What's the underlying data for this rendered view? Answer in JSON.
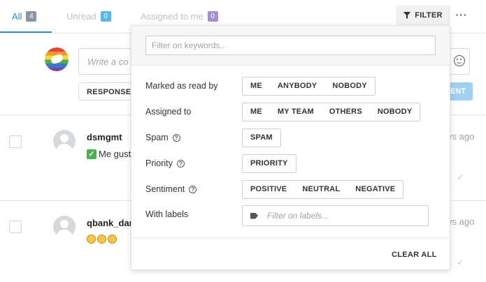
{
  "tabs": [
    {
      "label": "All",
      "count": "4"
    },
    {
      "label": "Unread",
      "count": "0"
    },
    {
      "label": "Assigned to me",
      "count": "0"
    }
  ],
  "toolbar": {
    "filter_label": "FILTER",
    "more_label": "···"
  },
  "compose": {
    "placeholder": "Write a co",
    "response_label": "RESPONSE T",
    "send_label": "ENT"
  },
  "messages": [
    {
      "username": "dsmgmt",
      "text": "Me gust",
      "time": "ys ago"
    },
    {
      "username": "qbank_dar",
      "text": "",
      "time": "ys ago"
    }
  ],
  "filter_panel": {
    "keywords_placeholder": "Filter on keywords...",
    "rows": [
      {
        "label": "Marked as read by",
        "options": [
          "ME",
          "ANYBODY",
          "NOBODY"
        ]
      },
      {
        "label": "Assigned to",
        "options": [
          "ME",
          "MY TEAM",
          "OTHERS",
          "NOBODY"
        ]
      },
      {
        "label": "Spam",
        "options": [
          "SPAM"
        ]
      },
      {
        "label": "Priority",
        "options": [
          "PRIORITY"
        ]
      },
      {
        "label": "Sentiment",
        "options": [
          "POSITIVE",
          "NEUTRAL",
          "NEGATIVE"
        ]
      }
    ],
    "labels_row": {
      "label": "With labels",
      "placeholder": "Filter on labels..."
    },
    "clear_all_label": "CLEAR ALL"
  },
  "colors": {
    "accent": "#2f8ed4",
    "send_disabled": "#9fd0f2"
  }
}
